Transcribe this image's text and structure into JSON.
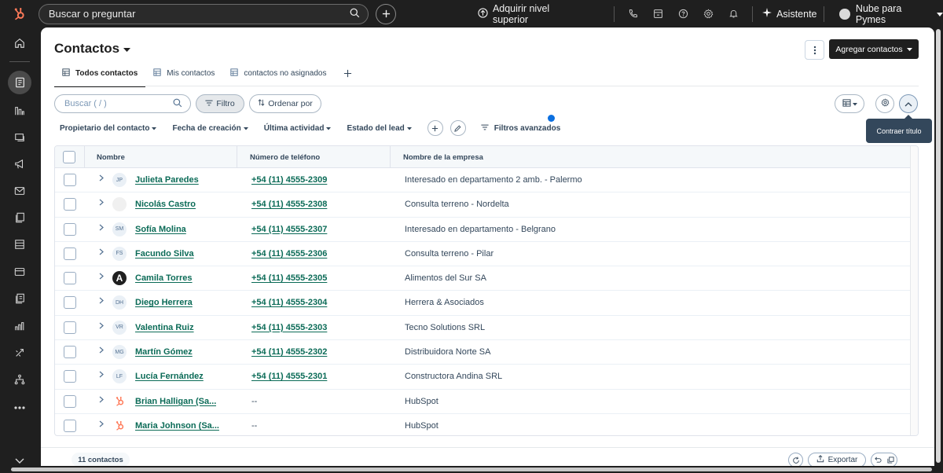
{
  "topbar": {
    "search_placeholder": "Buscar o preguntar",
    "upgrade_label": "Adquirir nivel superior",
    "assistant_label": "Asistente",
    "account_label": "Nube para Pymes"
  },
  "page": {
    "title": "Contactos",
    "add_button": "Agregar contactos"
  },
  "tabs": [
    {
      "label": "Todos contactos",
      "active": true
    },
    {
      "label": "Mis contactos",
      "active": false
    },
    {
      "label": "contactos no asignados",
      "active": false
    }
  ],
  "toolbar": {
    "search_placeholder": "Buscar ( / )",
    "filter_label": "Filtro",
    "sort_label": "Ordenar por",
    "tooltip": "Contraer título"
  },
  "filters": {
    "owner": "Propietario del contacto",
    "created": "Fecha de creación",
    "last_activity": "Última actividad",
    "lead_status": "Estado del lead",
    "advanced": "Filtros avanzados"
  },
  "table": {
    "headers": {
      "name": "Nombre",
      "phone": "Número de teléfono",
      "company": "Nombre de la empresa"
    },
    "rows": [
      {
        "avatar": "JP",
        "avatar_style": "initials",
        "name": "Julieta Paredes",
        "phone": "+54 (11) 4555-2309",
        "company": "Interesado en departamento 2 amb. - Palermo"
      },
      {
        "avatar": "",
        "avatar_style": "light",
        "name": "Nicolás Castro",
        "phone": "+54 (11) 4555-2308",
        "company": "Consulta terreno - Nordelta"
      },
      {
        "avatar": "SM",
        "avatar_style": "initials",
        "name": "Sofía Molina",
        "phone": "+54 (11) 4555-2307",
        "company": "Interesado en departamento - Belgrano"
      },
      {
        "avatar": "FS",
        "avatar_style": "initials",
        "name": "Facundo Silva",
        "phone": "+54 (11) 4555-2306",
        "company": "Consulta terreno - Pilar"
      },
      {
        "avatar": "A",
        "avatar_style": "dark",
        "name": "Camila Torres",
        "phone": "+54 (11) 4555-2305",
        "company": "Alimentos del Sur SA"
      },
      {
        "avatar": "DH",
        "avatar_style": "initials",
        "name": "Diego Herrera",
        "phone": "+54 (11) 4555-2304",
        "company": "Herrera & Asociados"
      },
      {
        "avatar": "VR",
        "avatar_style": "initials",
        "name": "Valentina Ruiz",
        "phone": "+54 (11) 4555-2303",
        "company": "Tecno Solutions SRL"
      },
      {
        "avatar": "MG",
        "avatar_style": "initials",
        "name": "Martín Gómez",
        "phone": "+54 (11) 4555-2302",
        "company": "Distribuidora Norte SA"
      },
      {
        "avatar": "LF",
        "avatar_style": "initials",
        "name": "Lucía Fernández",
        "phone": "+54 (11) 4555-2301",
        "company": "Constructora Andina SRL"
      },
      {
        "avatar": "",
        "avatar_style": "hubspot",
        "name": "Brian Halligan (Sa...",
        "phone": "--",
        "company": "HubSpot"
      },
      {
        "avatar": "",
        "avatar_style": "hubspot",
        "name": "Maria Johnson (Sa...",
        "phone": "--",
        "company": "HubSpot"
      }
    ]
  },
  "footer": {
    "count_label": "11 contactos",
    "export_label": "Exportar"
  },
  "colors": {
    "link": "#0b6b57",
    "brand_orange": "#ff7a59",
    "dark": "#1f1f1f"
  }
}
